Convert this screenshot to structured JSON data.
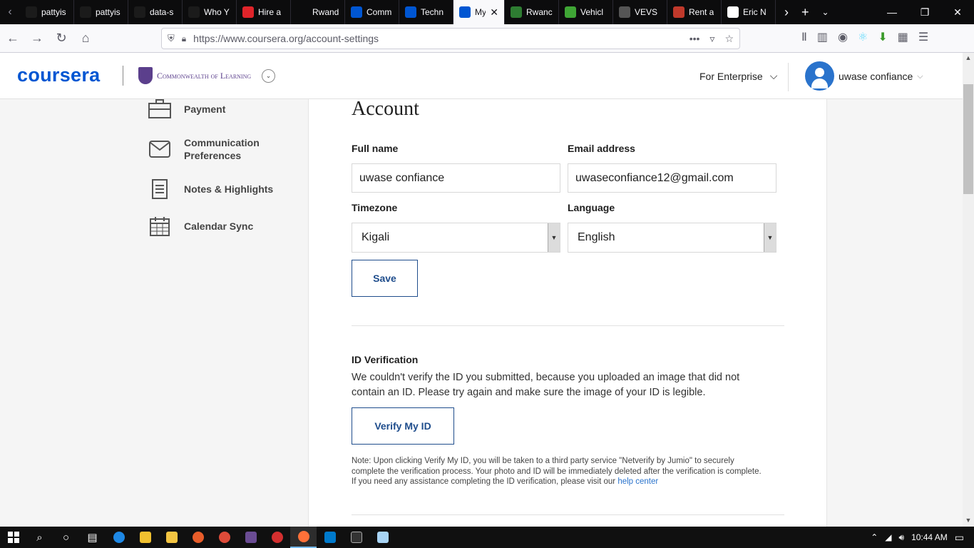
{
  "browser": {
    "tabs": [
      {
        "label": "pattyis",
        "color": "#1b1b1b"
      },
      {
        "label": "pattyis",
        "color": "#1b1b1b"
      },
      {
        "label": "data-s",
        "color": "#1b1b1b"
      },
      {
        "label": "Who Y",
        "color": "#1b1b1b"
      },
      {
        "label": "Hire a",
        "color": "#e0242a"
      },
      {
        "label": "Rwanda C",
        "color": "#0c0c0d"
      },
      {
        "label": "Comm",
        "color": "#0056d2"
      },
      {
        "label": "Techn",
        "color": "#0056d2"
      },
      {
        "label": "My",
        "color": "#0056d2",
        "active": true
      },
      {
        "label": "Rwanc",
        "color": "#2e7d32"
      },
      {
        "label": "Vehicl",
        "color": "#3fa535"
      },
      {
        "label": "VEVS",
        "color": "#555555"
      },
      {
        "label": "Rent a",
        "color": "#c0392b"
      },
      {
        "label": "Eric N",
        "color": "#ffffff"
      }
    ],
    "url": "https://www.coursera.org/account-settings",
    "icons": {
      "back": "back-arrow-icon",
      "forward": "forward-arrow-icon",
      "reload": "reload-icon",
      "home": "home-icon"
    }
  },
  "header": {
    "logo": "coursera",
    "partner": "Commonwealth of Learning",
    "enterprise": "For Enterprise",
    "user": "uwase confiance"
  },
  "sidebar": {
    "items": [
      {
        "label": "Payment",
        "icon": "briefcase-icon"
      },
      {
        "label": "Communication Preferences",
        "icon": "envelope-icon"
      },
      {
        "label": "Notes & Highlights",
        "icon": "notes-icon"
      },
      {
        "label": "Calendar Sync",
        "icon": "calendar-icon"
      }
    ]
  },
  "account": {
    "title": "Account",
    "full_name_label": "Full name",
    "full_name_value": "uwase confiance",
    "email_label": "Email address",
    "email_value": "uwaseconfiance12@gmail.com",
    "timezone_label": "Timezone",
    "timezone_value": "Kigali",
    "language_label": "Language",
    "language_value": "English",
    "save_label": "Save"
  },
  "verification": {
    "title": "ID Verification",
    "message": "We couldn't verify the ID you submitted, because you uploaded an image that did not contain an ID. Please try again and make sure the image of your ID is legible.",
    "button": "Verify My ID",
    "note": "Note: Upon clicking Verify My ID, you will be taken to a third party service \"Netverify by Jumio\" to securely complete the verification process. Your photo and ID will be immediately deleted after the verification is complete. If you need any assistance completing the ID verification, please visit our",
    "help_link": "help center"
  },
  "taskbar": {
    "time": "10:44 AM"
  },
  "colors": {
    "brand": "#0056d2",
    "button_border": "#1f4d8c",
    "link": "#2a73cc"
  }
}
